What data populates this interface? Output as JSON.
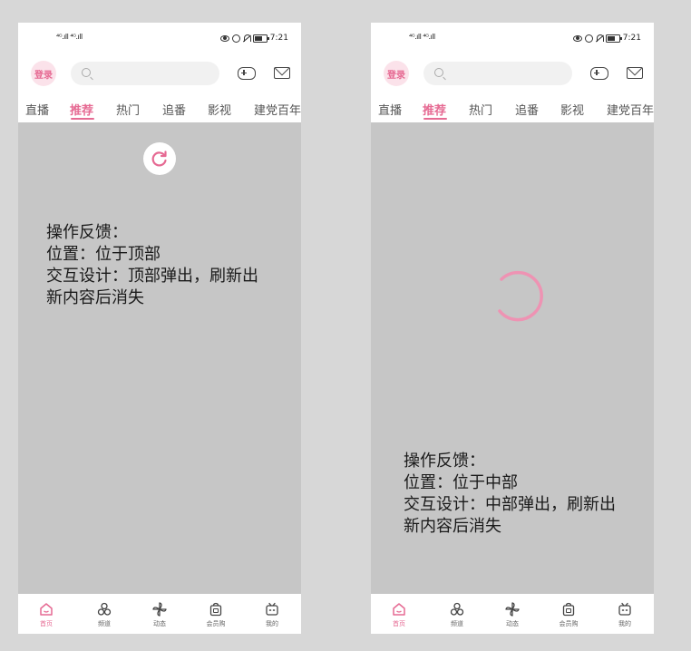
{
  "colors": {
    "accent": "#e66a93",
    "canvas_bg": "#d7d7d7",
    "content_bg": "#c6c6c6"
  },
  "status_bar": {
    "signal_text": "⁴ᴳ.ıll ⁴ᴳ.ıll",
    "time": "7:21"
  },
  "header": {
    "login_label": "登录"
  },
  "tabs": [
    {
      "label": "直播",
      "active": false
    },
    {
      "label": "推荐",
      "active": true
    },
    {
      "label": "热门",
      "active": false
    },
    {
      "label": "追番",
      "active": false
    },
    {
      "label": "影视",
      "active": false
    },
    {
      "label": "建党百年",
      "active": false
    }
  ],
  "bottom_nav": [
    {
      "label": "首页",
      "icon": "home-icon",
      "active": true
    },
    {
      "label": "频道",
      "icon": "channel-icon",
      "active": false
    },
    {
      "label": "动态",
      "icon": "pinwheel-icon",
      "active": false
    },
    {
      "label": "会员购",
      "icon": "shopping-bag-icon",
      "active": false
    },
    {
      "label": "我的",
      "icon": "tv-icon",
      "active": false
    }
  ],
  "panels": {
    "top": {
      "feedback_text": "操作反馈：\n位置：位于顶部\n交互设计：顶部弹出，刷新出新内容后消失"
    },
    "middle": {
      "feedback_text": "操作反馈：\n位置：位于中部\n交互设计：中部弹出，刷新出新内容后消失"
    }
  }
}
